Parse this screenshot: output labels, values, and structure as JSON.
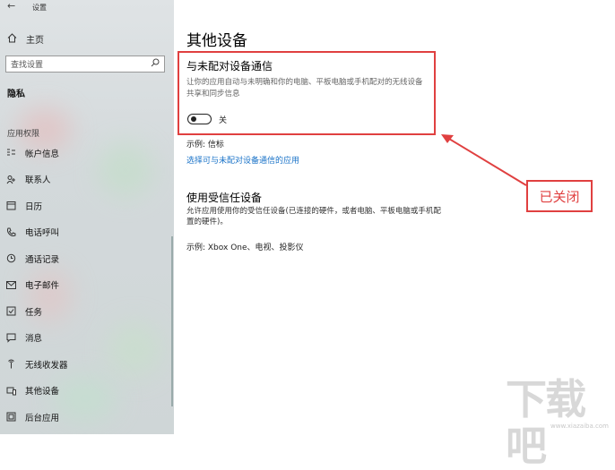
{
  "window": {
    "title": "设置"
  },
  "sidebar": {
    "home_label": "主页",
    "search_placeholder": "查找设置",
    "section_title": "隐私",
    "group_title": "应用权限",
    "items": [
      {
        "label": "帐户信息",
        "icon": "account-info-icon"
      },
      {
        "label": "联系人",
        "icon": "contacts-icon"
      },
      {
        "label": "日历",
        "icon": "calendar-icon"
      },
      {
        "label": "电话呼叫",
        "icon": "phone-icon"
      },
      {
        "label": "通话记录",
        "icon": "call-history-icon"
      },
      {
        "label": "电子邮件",
        "icon": "email-icon"
      },
      {
        "label": "任务",
        "icon": "tasks-icon"
      },
      {
        "label": "消息",
        "icon": "messaging-icon"
      },
      {
        "label": "无线收发器",
        "icon": "radios-icon"
      },
      {
        "label": "其他设备",
        "icon": "other-devices-icon"
      },
      {
        "label": "后台应用",
        "icon": "background-apps-icon"
      }
    ]
  },
  "main": {
    "title": "其他设备",
    "unpaired": {
      "heading": "与未配对设备通信",
      "description": "让你的应用自动与未明确和你的电脑、平板电脑或手机配对的无线设备共享和同步信息",
      "toggle_state": "关",
      "toggle_on": false,
      "example": "示例: 信标",
      "link": "选择可与未配对设备通信的应用"
    },
    "trusted": {
      "heading": "使用受信任设备",
      "description": "允许应用使用你的受信任设备(已连接的硬件，或者电脑、平板电脑或手机配置的硬件)。",
      "example": "示例: Xbox One、电视、投影仪"
    },
    "callout": "已关闭"
  },
  "watermark": {
    "text": "下载吧",
    "sub": "www.xiazaiba.com"
  },
  "colors": {
    "accent_link": "#1a73c8",
    "annotation_red": "#e04040"
  }
}
